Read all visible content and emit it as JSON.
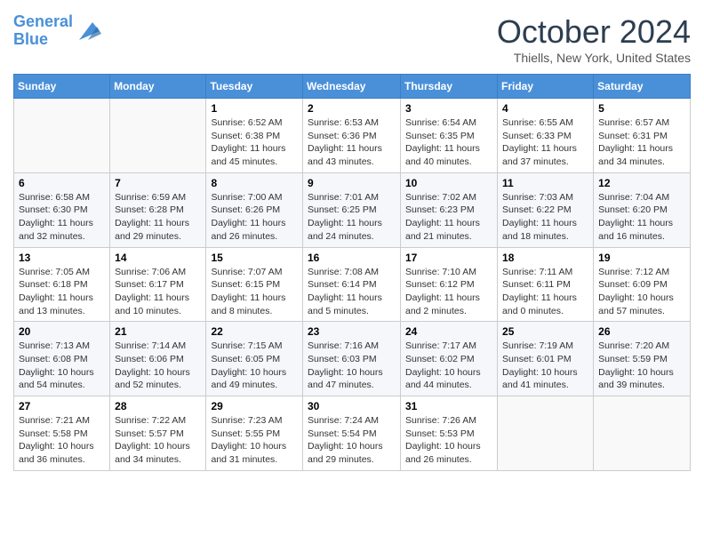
{
  "header": {
    "logo_line1": "General",
    "logo_line2": "Blue",
    "month_title": "October 2024",
    "location": "Thiells, New York, United States"
  },
  "days_of_week": [
    "Sunday",
    "Monday",
    "Tuesday",
    "Wednesday",
    "Thursday",
    "Friday",
    "Saturday"
  ],
  "weeks": [
    [
      null,
      null,
      {
        "day": "1",
        "sunrise": "Sunrise: 6:52 AM",
        "sunset": "Sunset: 6:38 PM",
        "daylight": "Daylight: 11 hours and 45 minutes."
      },
      {
        "day": "2",
        "sunrise": "Sunrise: 6:53 AM",
        "sunset": "Sunset: 6:36 PM",
        "daylight": "Daylight: 11 hours and 43 minutes."
      },
      {
        "day": "3",
        "sunrise": "Sunrise: 6:54 AM",
        "sunset": "Sunset: 6:35 PM",
        "daylight": "Daylight: 11 hours and 40 minutes."
      },
      {
        "day": "4",
        "sunrise": "Sunrise: 6:55 AM",
        "sunset": "Sunset: 6:33 PM",
        "daylight": "Daylight: 11 hours and 37 minutes."
      },
      {
        "day": "5",
        "sunrise": "Sunrise: 6:57 AM",
        "sunset": "Sunset: 6:31 PM",
        "daylight": "Daylight: 11 hours and 34 minutes."
      }
    ],
    [
      {
        "day": "6",
        "sunrise": "Sunrise: 6:58 AM",
        "sunset": "Sunset: 6:30 PM",
        "daylight": "Daylight: 11 hours and 32 minutes."
      },
      {
        "day": "7",
        "sunrise": "Sunrise: 6:59 AM",
        "sunset": "Sunset: 6:28 PM",
        "daylight": "Daylight: 11 hours and 29 minutes."
      },
      {
        "day": "8",
        "sunrise": "Sunrise: 7:00 AM",
        "sunset": "Sunset: 6:26 PM",
        "daylight": "Daylight: 11 hours and 26 minutes."
      },
      {
        "day": "9",
        "sunrise": "Sunrise: 7:01 AM",
        "sunset": "Sunset: 6:25 PM",
        "daylight": "Daylight: 11 hours and 24 minutes."
      },
      {
        "day": "10",
        "sunrise": "Sunrise: 7:02 AM",
        "sunset": "Sunset: 6:23 PM",
        "daylight": "Daylight: 11 hours and 21 minutes."
      },
      {
        "day": "11",
        "sunrise": "Sunrise: 7:03 AM",
        "sunset": "Sunset: 6:22 PM",
        "daylight": "Daylight: 11 hours and 18 minutes."
      },
      {
        "day": "12",
        "sunrise": "Sunrise: 7:04 AM",
        "sunset": "Sunset: 6:20 PM",
        "daylight": "Daylight: 11 hours and 16 minutes."
      }
    ],
    [
      {
        "day": "13",
        "sunrise": "Sunrise: 7:05 AM",
        "sunset": "Sunset: 6:18 PM",
        "daylight": "Daylight: 11 hours and 13 minutes."
      },
      {
        "day": "14",
        "sunrise": "Sunrise: 7:06 AM",
        "sunset": "Sunset: 6:17 PM",
        "daylight": "Daylight: 11 hours and 10 minutes."
      },
      {
        "day": "15",
        "sunrise": "Sunrise: 7:07 AM",
        "sunset": "Sunset: 6:15 PM",
        "daylight": "Daylight: 11 hours and 8 minutes."
      },
      {
        "day": "16",
        "sunrise": "Sunrise: 7:08 AM",
        "sunset": "Sunset: 6:14 PM",
        "daylight": "Daylight: 11 hours and 5 minutes."
      },
      {
        "day": "17",
        "sunrise": "Sunrise: 7:10 AM",
        "sunset": "Sunset: 6:12 PM",
        "daylight": "Daylight: 11 hours and 2 minutes."
      },
      {
        "day": "18",
        "sunrise": "Sunrise: 7:11 AM",
        "sunset": "Sunset: 6:11 PM",
        "daylight": "Daylight: 11 hours and 0 minutes."
      },
      {
        "day": "19",
        "sunrise": "Sunrise: 7:12 AM",
        "sunset": "Sunset: 6:09 PM",
        "daylight": "Daylight: 10 hours and 57 minutes."
      }
    ],
    [
      {
        "day": "20",
        "sunrise": "Sunrise: 7:13 AM",
        "sunset": "Sunset: 6:08 PM",
        "daylight": "Daylight: 10 hours and 54 minutes."
      },
      {
        "day": "21",
        "sunrise": "Sunrise: 7:14 AM",
        "sunset": "Sunset: 6:06 PM",
        "daylight": "Daylight: 10 hours and 52 minutes."
      },
      {
        "day": "22",
        "sunrise": "Sunrise: 7:15 AM",
        "sunset": "Sunset: 6:05 PM",
        "daylight": "Daylight: 10 hours and 49 minutes."
      },
      {
        "day": "23",
        "sunrise": "Sunrise: 7:16 AM",
        "sunset": "Sunset: 6:03 PM",
        "daylight": "Daylight: 10 hours and 47 minutes."
      },
      {
        "day": "24",
        "sunrise": "Sunrise: 7:17 AM",
        "sunset": "Sunset: 6:02 PM",
        "daylight": "Daylight: 10 hours and 44 minutes."
      },
      {
        "day": "25",
        "sunrise": "Sunrise: 7:19 AM",
        "sunset": "Sunset: 6:01 PM",
        "daylight": "Daylight: 10 hours and 41 minutes."
      },
      {
        "day": "26",
        "sunrise": "Sunrise: 7:20 AM",
        "sunset": "Sunset: 5:59 PM",
        "daylight": "Daylight: 10 hours and 39 minutes."
      }
    ],
    [
      {
        "day": "27",
        "sunrise": "Sunrise: 7:21 AM",
        "sunset": "Sunset: 5:58 PM",
        "daylight": "Daylight: 10 hours and 36 minutes."
      },
      {
        "day": "28",
        "sunrise": "Sunrise: 7:22 AM",
        "sunset": "Sunset: 5:57 PM",
        "daylight": "Daylight: 10 hours and 34 minutes."
      },
      {
        "day": "29",
        "sunrise": "Sunrise: 7:23 AM",
        "sunset": "Sunset: 5:55 PM",
        "daylight": "Daylight: 10 hours and 31 minutes."
      },
      {
        "day": "30",
        "sunrise": "Sunrise: 7:24 AM",
        "sunset": "Sunset: 5:54 PM",
        "daylight": "Daylight: 10 hours and 29 minutes."
      },
      {
        "day": "31",
        "sunrise": "Sunrise: 7:26 AM",
        "sunset": "Sunset: 5:53 PM",
        "daylight": "Daylight: 10 hours and 26 minutes."
      },
      null,
      null
    ]
  ]
}
